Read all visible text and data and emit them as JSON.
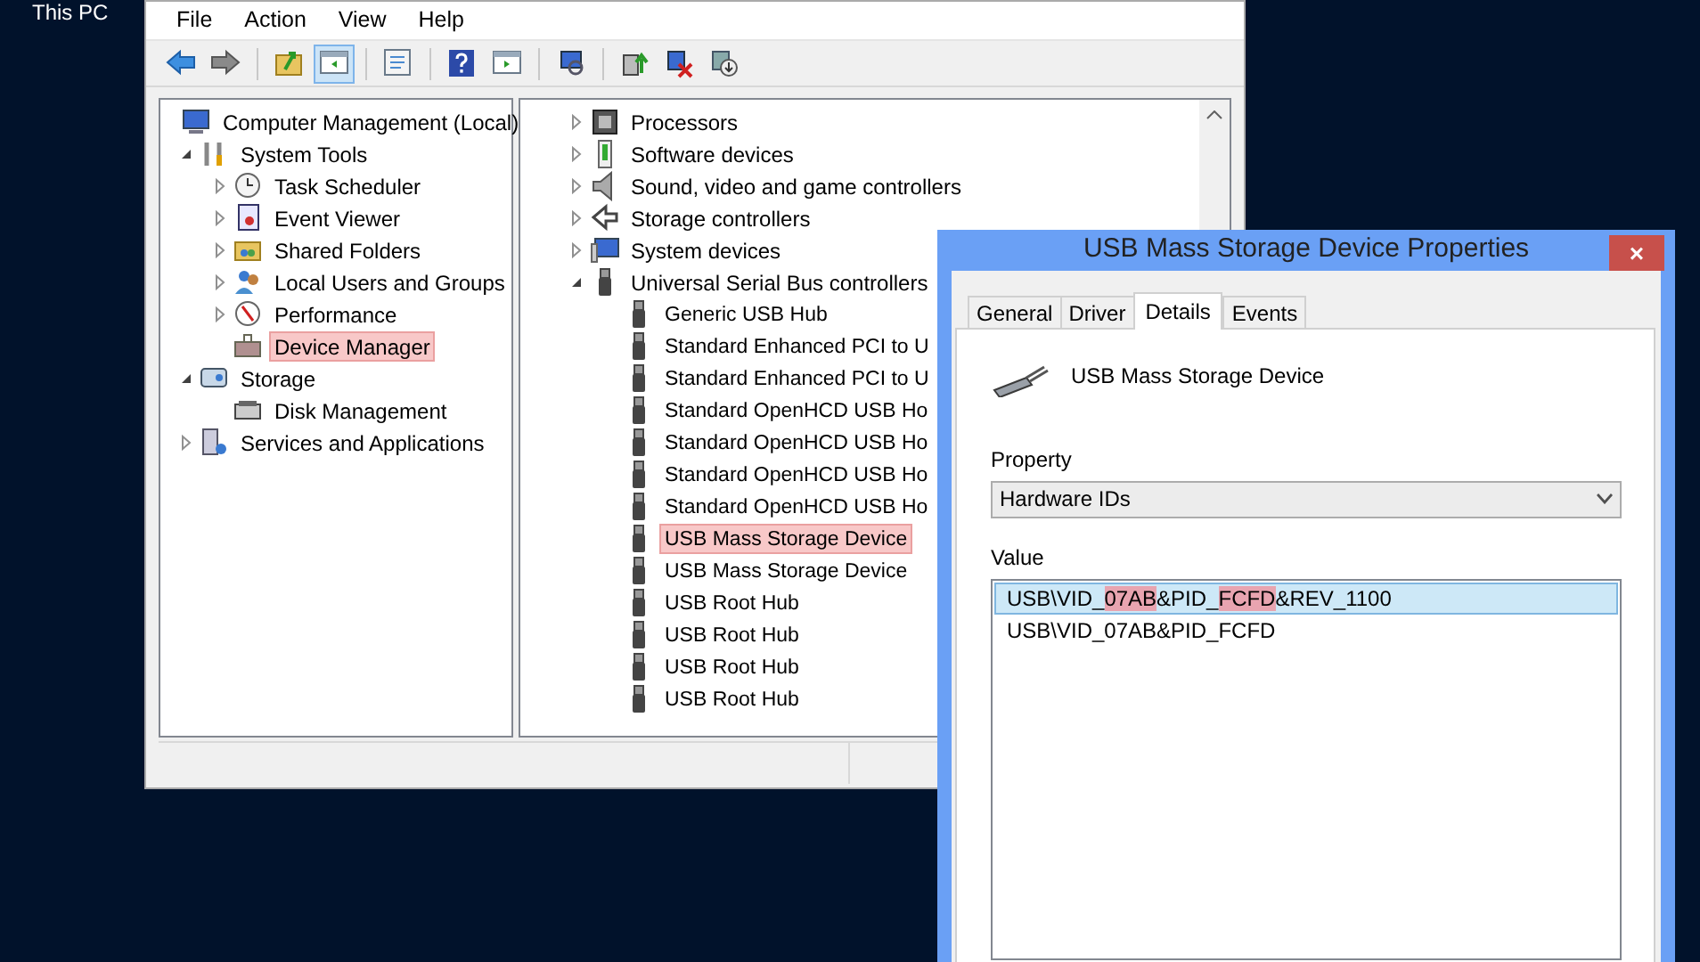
{
  "desktop": {
    "icon_label": "This PC"
  },
  "main_window": {
    "menu": [
      "File",
      "Action",
      "View",
      "Help"
    ],
    "toolbar_groups": [
      {
        "buttons": [
          {
            "pressed": false
          },
          {
            "pressed": false
          }
        ]
      },
      {
        "buttons": [
          {
            "pressed": false
          },
          {
            "pressed": true
          }
        ]
      },
      {
        "buttons": [
          {
            "pressed": false
          }
        ]
      },
      {
        "buttons": [
          {
            "pressed": false
          },
          {
            "pressed": false
          }
        ]
      },
      {
        "buttons": [
          {
            "pressed": false
          }
        ]
      },
      {
        "buttons": [
          {
            "pressed": false
          },
          {
            "pressed": false
          },
          {
            "pressed": false
          }
        ]
      }
    ],
    "console_tree": [
      {
        "label": "Computer Management (Local)",
        "selected": false,
        "children": [
          {
            "label": "System Tools",
            "expanded": true,
            "selected": false,
            "children": [
              {
                "label": "Task Scheduler",
                "expanded": false,
                "selected": false
              },
              {
                "label": "Event Viewer",
                "expanded": false,
                "selected": false
              },
              {
                "label": "Shared Folders",
                "expanded": false,
                "selected": false
              },
              {
                "label": "Local Users and Groups",
                "expanded": false,
                "selected": false
              },
              {
                "label": "Performance",
                "expanded": false,
                "selected": false
              },
              {
                "label": "Device Manager",
                "selected": true
              }
            ]
          },
          {
            "label": "Storage",
            "expanded": true,
            "selected": false,
            "children": [
              {
                "label": "Disk Management",
                "selected": false
              }
            ]
          },
          {
            "label": "Services and Applications",
            "expanded": false,
            "selected": false
          }
        ]
      }
    ],
    "device_tree": [
      {
        "label": "Processors",
        "expanded": false,
        "selected": false
      },
      {
        "label": "Software devices",
        "expanded": false,
        "selected": false
      },
      {
        "label": "Sound, video and game controllers",
        "expanded": false,
        "selected": false
      },
      {
        "label": "Storage controllers",
        "expanded": false,
        "selected": false
      },
      {
        "label": "System devices",
        "expanded": false,
        "selected": false
      },
      {
        "label": "Universal Serial Bus controllers",
        "expanded": true,
        "selected": false,
        "children": [
          {
            "label": "Generic USB Hub",
            "selected": false
          },
          {
            "label": "Standard Enhanced PCI to U",
            "selected": false
          },
          {
            "label": "Standard Enhanced PCI to U",
            "selected": false
          },
          {
            "label": "Standard OpenHCD USB Ho",
            "selected": false
          },
          {
            "label": "Standard OpenHCD USB Ho",
            "selected": false
          },
          {
            "label": "Standard OpenHCD USB Ho",
            "selected": false
          },
          {
            "label": "Standard OpenHCD USB Ho",
            "selected": false
          },
          {
            "label": "USB Mass Storage Device",
            "selected": true
          },
          {
            "label": "USB Mass Storage Device",
            "selected": false
          },
          {
            "label": "USB Root Hub",
            "selected": false
          },
          {
            "label": "USB Root Hub",
            "selected": false
          },
          {
            "label": "USB Root Hub",
            "selected": false
          },
          {
            "label": "USB Root Hub",
            "selected": false
          }
        ]
      }
    ]
  },
  "dialog": {
    "title": "USB Mass Storage Device Properties",
    "close": "×",
    "tabs": [
      {
        "label": "General",
        "selected": false
      },
      {
        "label": "Driver",
        "selected": false
      },
      {
        "label": "Details",
        "selected": true
      },
      {
        "label": "Events",
        "selected": false
      }
    ],
    "device_name": "USB Mass Storage Device",
    "property_label": "Property",
    "property_value": "Hardware IDs",
    "value_label": "Value",
    "values": [
      {
        "selected": true,
        "segments": [
          {
            "text": "USB\\VID_",
            "marked": false
          },
          {
            "text": "07AB",
            "marked": true
          },
          {
            "text": "&PID_",
            "marked": false
          },
          {
            "text": "FCFD",
            "marked": true
          },
          {
            "text": "&REV_1100",
            "marked": false
          }
        ]
      },
      {
        "selected": false,
        "segments": [
          {
            "text": "USB\\VID_07AB&PID_FCFD",
            "marked": false
          }
        ]
      }
    ]
  }
}
